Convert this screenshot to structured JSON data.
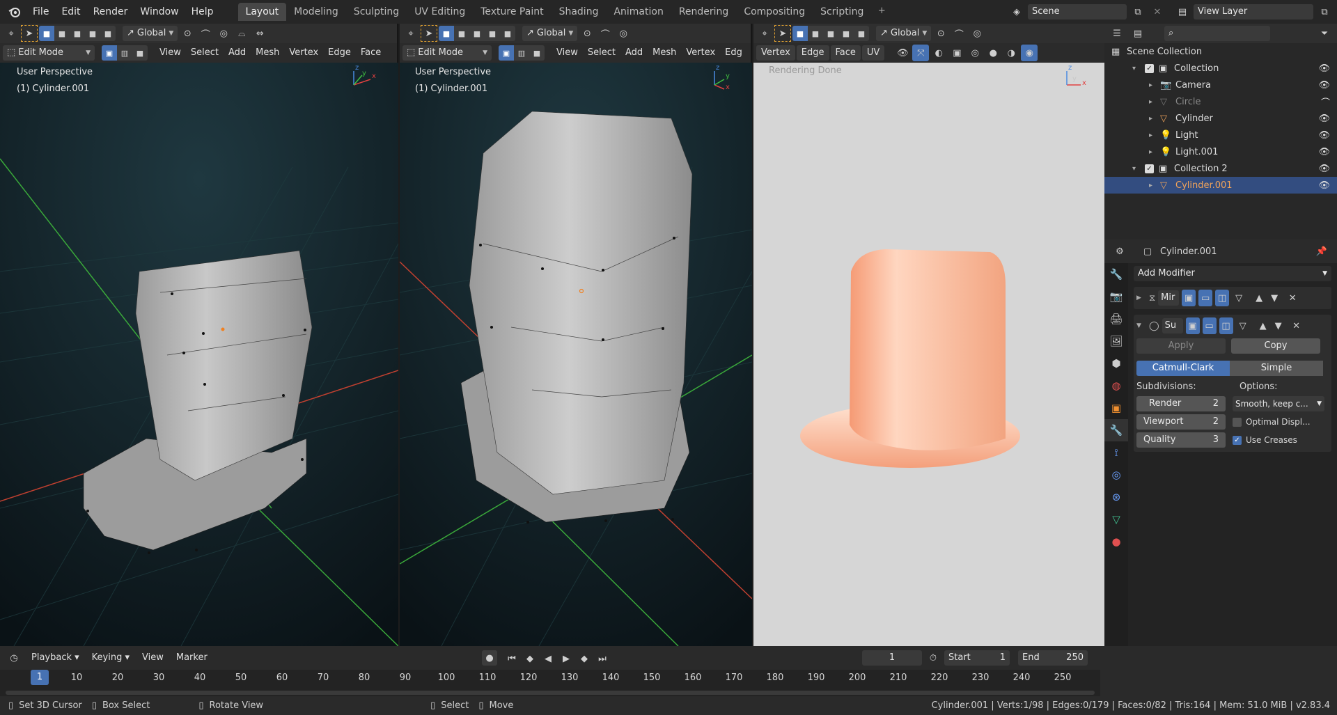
{
  "topbar": {
    "menus": [
      "File",
      "Edit",
      "Render",
      "Window",
      "Help"
    ],
    "workspaces": [
      "Layout",
      "Modeling",
      "Sculpting",
      "UV Editing",
      "Texture Paint",
      "Shading",
      "Animation",
      "Rendering",
      "Compositing",
      "Scripting"
    ],
    "active_workspace": "Layout",
    "add_workspace": "+",
    "scene": "Scene",
    "view_layer": "View Layer"
  },
  "viewport1": {
    "mode": "Edit Mode",
    "orientation": "Global",
    "menus": [
      "View",
      "Select",
      "Add",
      "Mesh",
      "Vertex",
      "Edge",
      "Face"
    ],
    "perspective": "User Perspective",
    "object": "(1) Cylinder.001",
    "axis_x": "x",
    "axis_y": "y",
    "axis_z": "z"
  },
  "viewport2": {
    "mode": "Edit Mode",
    "orientation": "Global",
    "menus": [
      "View",
      "Select",
      "Add",
      "Mesh",
      "Vertex",
      "Edg"
    ],
    "perspective": "User Perspective",
    "object": "(1) Cylinder.001",
    "axis_x": "x",
    "axis_y": "y",
    "axis_z": "z"
  },
  "viewport3": {
    "orientation": "Global",
    "menus": [
      "Vertex",
      "Edge",
      "Face",
      "UV"
    ],
    "status": "Rendering Done",
    "axis_x": "x",
    "axis_y": "y",
    "axis_z": "z"
  },
  "outliner": {
    "search_placeholder": "",
    "items": [
      {
        "label": "Scene Collection",
        "indent": 0,
        "type": "scene"
      },
      {
        "label": "Collection",
        "indent": 1,
        "type": "collection"
      },
      {
        "label": "Camera",
        "indent": 2,
        "type": "camera"
      },
      {
        "label": "Circle",
        "indent": 2,
        "type": "mesh",
        "dim": true
      },
      {
        "label": "Cylinder",
        "indent": 2,
        "type": "mesh"
      },
      {
        "label": "Light",
        "indent": 2,
        "type": "light"
      },
      {
        "label": "Light.001",
        "indent": 2,
        "type": "light"
      },
      {
        "label": "Collection 2",
        "indent": 1,
        "type": "collection"
      },
      {
        "label": "Cylinder.001",
        "indent": 2,
        "type": "mesh",
        "selected": true
      }
    ]
  },
  "properties": {
    "object_name": "Cylinder.001",
    "add_modifier": "Add Modifier",
    "modifier1_name": "Mir",
    "modifier2_name": "Su",
    "apply": "Apply",
    "copy": "Copy",
    "catmull": "Catmull-Clark",
    "simple": "Simple",
    "subdivisions_label": "Subdivisions:",
    "options_label": "Options:",
    "render_label": "Render",
    "render_value": "2",
    "viewport_label": "Viewport",
    "viewport_value": "2",
    "quality_label": "Quality",
    "quality_value": "3",
    "uv_smooth": "Smooth, keep c...",
    "optimal_display": "Optimal Displ...",
    "use_creases": "Use Creases",
    "optimal_display_checked": false,
    "use_creases_checked": true
  },
  "timeline": {
    "menus": [
      "Playback",
      "Keying",
      "View",
      "Marker"
    ],
    "current_frame": "1",
    "start_label": "Start",
    "start_value": "1",
    "end_label": "End",
    "end_value": "250",
    "ruler": [
      "10",
      "20",
      "30",
      "40",
      "50",
      "60",
      "70",
      "80",
      "90",
      "100",
      "110",
      "120",
      "130",
      "140",
      "150",
      "160",
      "170",
      "180",
      "190",
      "200",
      "210",
      "220",
      "230",
      "240",
      "250"
    ],
    "ruler_current": "1"
  },
  "statusbar": {
    "hint1": "Set 3D Cursor",
    "hint2": "Box Select",
    "hint3": "Rotate View",
    "hint4": "Select",
    "hint5": "Move",
    "stats": "Cylinder.001 | Verts:1/98 | Edges:0/179 | Faces:0/82 | Tris:164 | Mem: 51.0 MiB | v2.83.4"
  },
  "colors": {
    "accent": "#4772b3",
    "selected_row": "#334d80",
    "object_name": "#f0a35a",
    "x_axis": "#e04040",
    "y_axis": "#40c040",
    "z_axis": "#4a8ae0"
  }
}
